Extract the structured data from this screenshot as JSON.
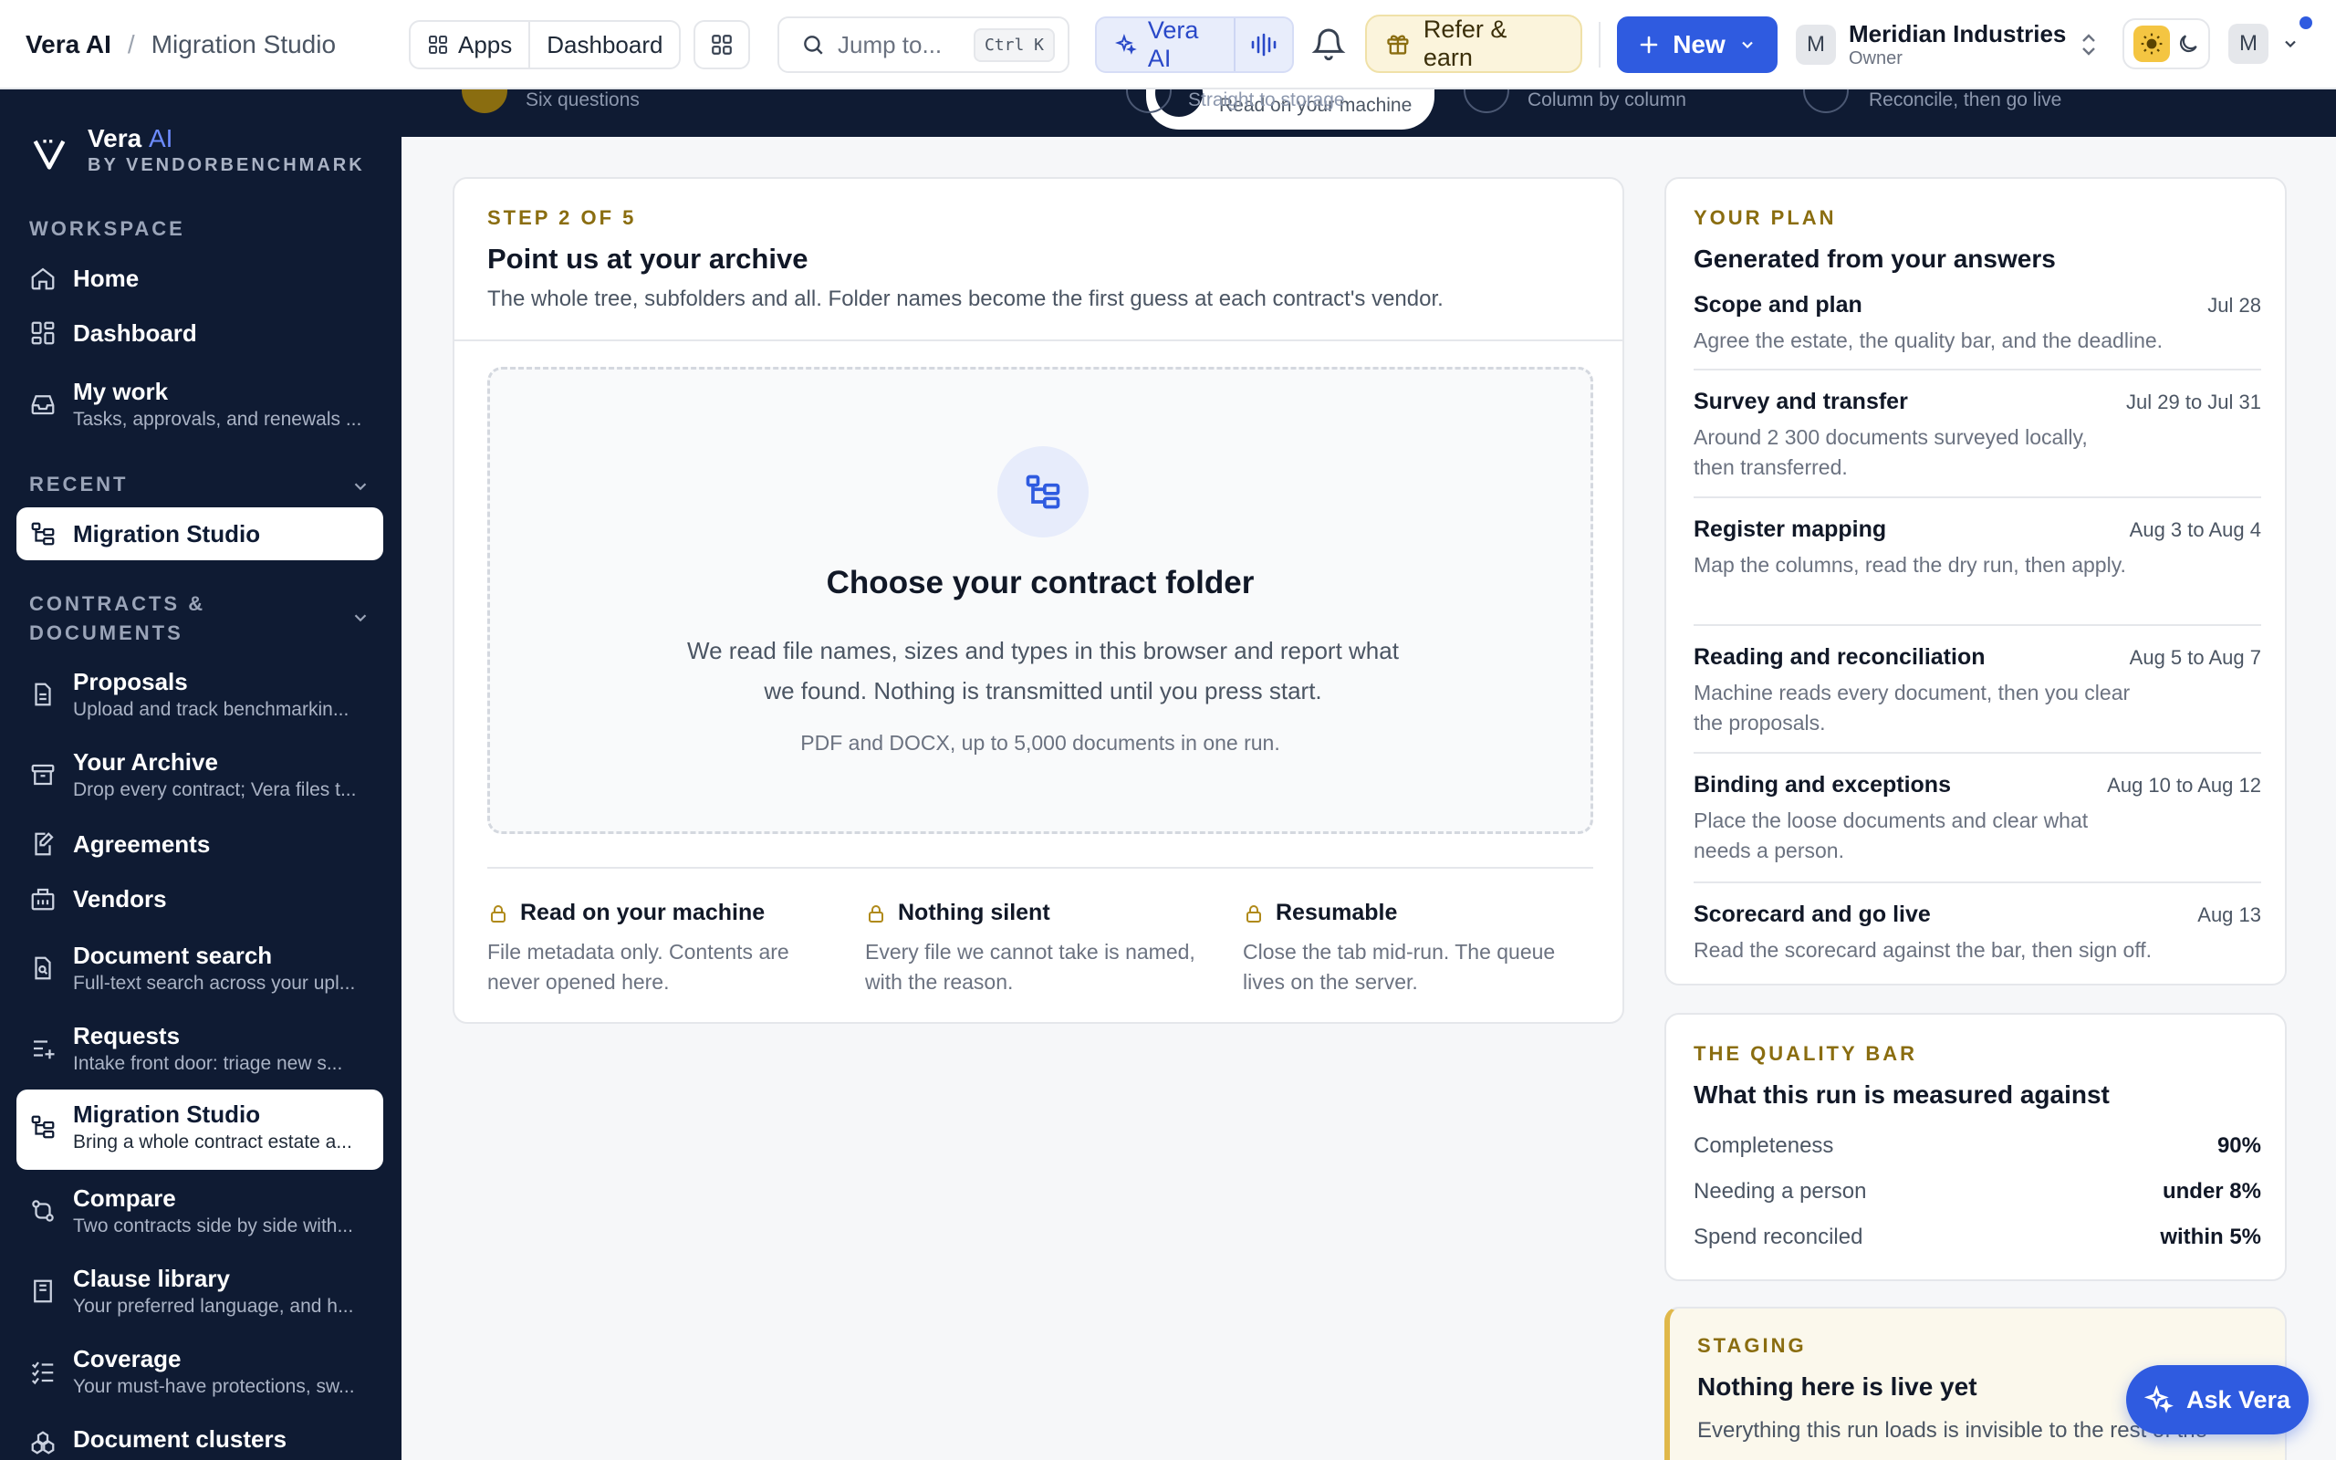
{
  "header": {
    "app_name": "Vera AI",
    "crumb_sep": "/",
    "current_page": "Migration Studio",
    "apps_label": "Apps",
    "dashboard_label": "Dashboard",
    "search_placeholder": "Jump to...",
    "search_shortcut": "Ctrl K",
    "vera_label": "Vera AI",
    "refer_label": "Refer & earn",
    "new_label": "New",
    "org_initial": "M",
    "org_name": "Meridian Industries",
    "org_role": "Owner",
    "user_initial": "M"
  },
  "sidebar": {
    "brand_name": "Vera",
    "brand_ai": "AI",
    "brand_sub": "BY VENDORBENCHMARK",
    "workspace_label": "WORKSPACE",
    "recent_label": "RECENT",
    "contracts_label_1": "CONTRACTS &",
    "contracts_label_2": "DOCUMENTS",
    "workspace_items": [
      {
        "label": "Home",
        "sub": ""
      },
      {
        "label": "Dashboard",
        "sub": ""
      },
      {
        "label": "My work",
        "sub": "Tasks, approvals, and renewals ..."
      }
    ],
    "recent_items": [
      {
        "label": "Migration Studio"
      }
    ],
    "contract_items": [
      {
        "label": "Proposals",
        "sub": "Upload and track benchmarkin..."
      },
      {
        "label": "Your Archive",
        "sub": "Drop every contract; Vera files t..."
      },
      {
        "label": "Agreements",
        "sub": ""
      },
      {
        "label": "Vendors",
        "sub": ""
      },
      {
        "label": "Document search",
        "sub": "Full-text search across your upl..."
      },
      {
        "label": "Requests",
        "sub": "Intake front door: triage new s..."
      },
      {
        "label": "Migration Studio",
        "sub": "Bring a whole contract estate a..."
      },
      {
        "label": "Compare",
        "sub": "Two contracts side by side with..."
      },
      {
        "label": "Clause library",
        "sub": "Your preferred language, and h..."
      },
      {
        "label": "Coverage",
        "sub": "Your must-have protections, sw..."
      },
      {
        "label": "Document clusters",
        "sub": ""
      }
    ]
  },
  "stepper": {
    "steps": [
      {
        "subtitle": "Six questions"
      },
      {
        "subtitle": "Read on your machine",
        "active": true
      },
      {
        "subtitle": "Straight to storage"
      },
      {
        "subtitle": "Column by column"
      },
      {
        "subtitle": "Reconcile, then go live"
      }
    ]
  },
  "main": {
    "eyebrow": "STEP 2 OF 5",
    "title": "Point us at your archive",
    "lead": "The whole tree, subfolders and all. Folder names become the first guess at each contract's vendor.",
    "drop_title": "Choose your contract folder",
    "drop_desc": "We read file names, sizes and types in this browser and report what we found. Nothing is transmitted until you press start.",
    "drop_note": "PDF and DOCX, up to 5,000 documents in one run.",
    "features": [
      {
        "title": "Read on your machine",
        "desc": "File metadata only. Contents are never opened here."
      },
      {
        "title": "Nothing silent",
        "desc": "Every file we cannot take is named, with the reason."
      },
      {
        "title": "Resumable",
        "desc": "Close the tab mid-run. The queue lives on the server."
      }
    ]
  },
  "plan": {
    "eyebrow": "YOUR PLAN",
    "title": "Generated from your answers",
    "rows": [
      {
        "title": "Scope and plan",
        "date": "Jul 28",
        "desc": "Agree the estate, the quality bar, and the deadline."
      },
      {
        "title": "Survey and transfer",
        "date": "Jul 29 to Jul 31",
        "desc": "Around 2 300 documents surveyed locally, then transferred."
      },
      {
        "title": "Register mapping",
        "date": "Aug 3 to Aug 4",
        "desc": "Map the columns, read the dry run, then apply."
      },
      {
        "title": "Reading and reconciliation",
        "date": "Aug 5 to Aug 7",
        "desc": "Machine reads every document, then you clear the proposals."
      },
      {
        "title": "Binding and exceptions",
        "date": "Aug 10 to Aug 12",
        "desc": "Place the loose documents and clear what needs a person."
      },
      {
        "title": "Scorecard and go live",
        "date": "Aug 13",
        "desc": "Read the scorecard against the bar, then sign off."
      }
    ]
  },
  "quality": {
    "eyebrow": "THE QUALITY BAR",
    "title": "What this run is measured against",
    "rows": [
      {
        "label": "Completeness",
        "value": "90%"
      },
      {
        "label": "Needing a person",
        "value": "under 8%"
      },
      {
        "label": "Spend reconciled",
        "value": "within 5%"
      }
    ]
  },
  "staging": {
    "eyebrow": "STAGING",
    "title": "Nothing here is live yet",
    "desc": "Everything this run loads is invisible to the rest of the"
  },
  "ask_vera": "Ask Vera",
  "colors": {
    "sidebar_bg": "#0f1b33",
    "accent": "#2f5be0",
    "eyebrow_gold": "#8a6d10"
  }
}
